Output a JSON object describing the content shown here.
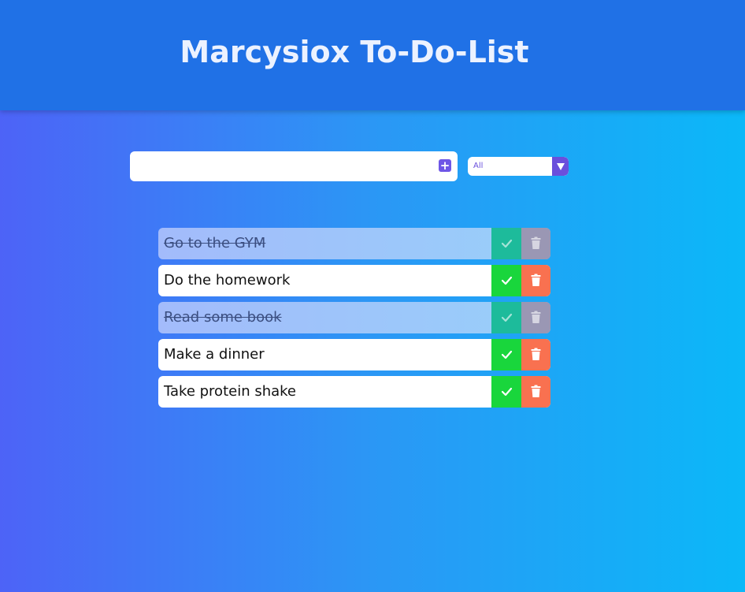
{
  "header": {
    "title": "Marcysiox To-Do-List"
  },
  "form": {
    "input_value": "",
    "add_icon": "plus-square-icon"
  },
  "filter": {
    "selected": "All",
    "arrow_icon": "caret-down-icon"
  },
  "todos": [
    {
      "text": "Go to the GYM",
      "completed": true
    },
    {
      "text": "Do the homework",
      "completed": false
    },
    {
      "text": "Read some book",
      "completed": true
    },
    {
      "text": "Make a dinner",
      "completed": false
    },
    {
      "text": "Take protein shake",
      "completed": false
    }
  ],
  "colors": {
    "header_bg": "#2071e6",
    "check": "#19d63c",
    "trash": "#f97150",
    "accent": "#6a4fdc"
  }
}
